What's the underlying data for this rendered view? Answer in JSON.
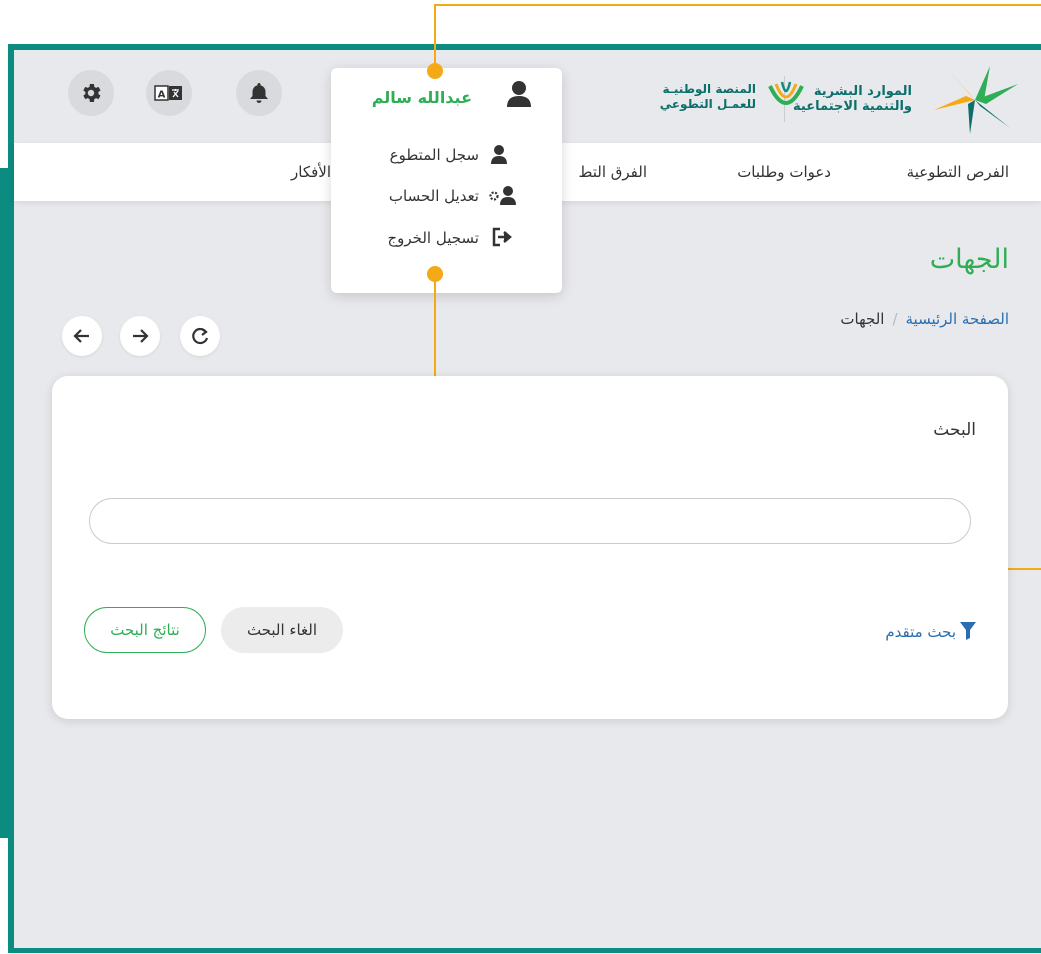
{
  "header": {
    "logo_primary": "الموارد البشرية\nوالتنمية الاجتماعية",
    "logo_secondary": "المنصة الوطنيـة\nللعمـل التطوعي",
    "icons": [
      "settings-gear-icon",
      "translate-icon",
      "bell-icon",
      "user-icon"
    ]
  },
  "nav": {
    "items": [
      "الفرص التطوعية",
      "دعوات وطلبات",
      "الفرق التط",
      "الأفكار"
    ]
  },
  "user_menu": {
    "user_name": "عبدالله سالم",
    "items": [
      {
        "label": "سجل المتطوع",
        "icon": "user-icon"
      },
      {
        "label": "تعديل الحساب",
        "icon": "user-settings-icon"
      },
      {
        "label": "تسجيل الخروج",
        "icon": "logout-icon"
      }
    ]
  },
  "page": {
    "title": "الجهات",
    "breadcrumb": {
      "home": "الصفحة الرئيسية",
      "separator": "/",
      "current": "الجهات"
    }
  },
  "search": {
    "label": "البحث",
    "value": "",
    "placeholder": "",
    "advanced_label": "بحث متقدم",
    "cancel_label": "الغاء البحث",
    "results_label": "نتائج البحث"
  },
  "colors": {
    "brand_teal": "#0c8b80",
    "accent_green": "#2fae56",
    "link_blue": "#2a6db0",
    "annotation_orange": "#f4a916",
    "background": "#e8e9ec"
  }
}
